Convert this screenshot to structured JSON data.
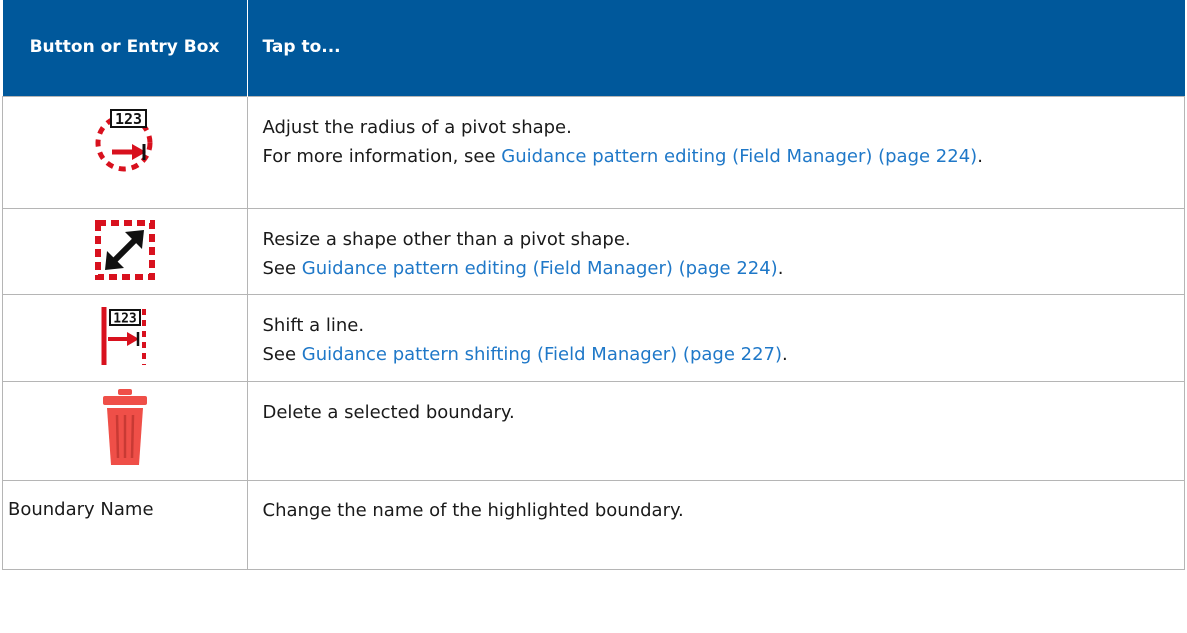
{
  "header": {
    "col1": "Button or Entry Box",
    "col2": "Tap to..."
  },
  "rows": [
    {
      "icon": "pivot-radius-icon",
      "text": "Adjust the radius of a pivot shape.",
      "note_prefix": "For more information, see ",
      "link": "Guidance pattern editing (Field Manager) (page 224)",
      "note_suffix": "."
    },
    {
      "icon": "resize-shape-icon",
      "text": "Resize a shape other than a pivot shape.",
      "note_prefix": "See ",
      "link": "Guidance pattern editing (Field Manager) (page 224)",
      "note_suffix": "."
    },
    {
      "icon": "shift-line-icon",
      "text": "Shift a line.",
      "note_prefix": "See ",
      "link": "Guidance pattern shifting (Field Manager) (page 227)",
      "note_suffix": "."
    },
    {
      "icon": "trash-icon",
      "text": "Delete a selected boundary."
    },
    {
      "label": "Boundary Name",
      "text": "Change the name of the highlighted boundary."
    }
  ],
  "icon_badge_text": "123",
  "colors": {
    "header_bg": "#00589b",
    "link": "#1f78c8",
    "icon_red": "#d8111e",
    "trash_red": "#ef4f48"
  }
}
